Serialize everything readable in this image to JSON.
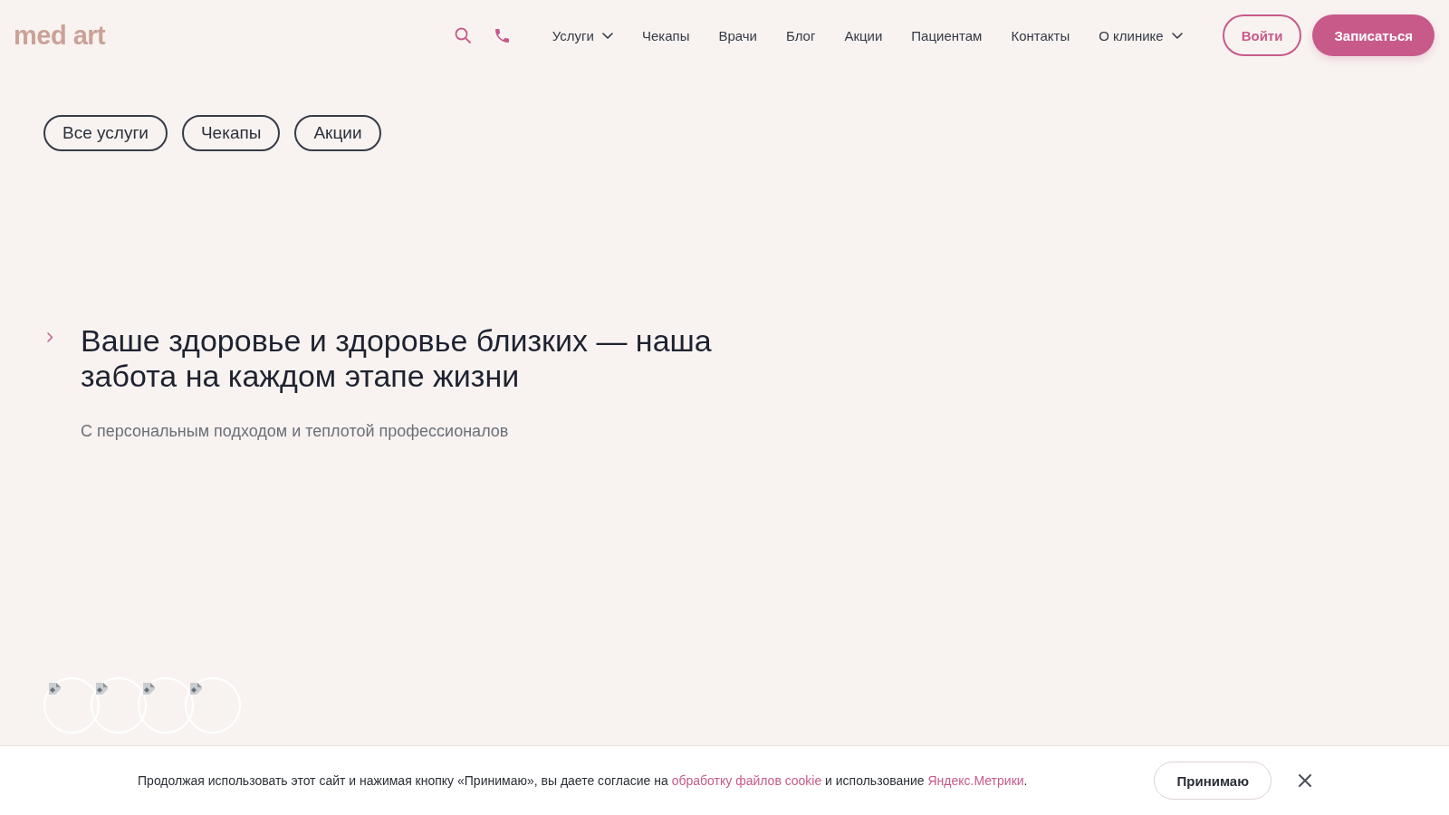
{
  "header": {
    "logo": "med art",
    "nav": [
      {
        "label": "Услуги",
        "dropdown": true
      },
      {
        "label": "Чекапы",
        "dropdown": false
      },
      {
        "label": "Врачи",
        "dropdown": false
      },
      {
        "label": "Блог",
        "dropdown": false
      },
      {
        "label": "Акции",
        "dropdown": false
      },
      {
        "label": "Пациентам",
        "dropdown": false
      },
      {
        "label": "Контакты",
        "dropdown": false
      },
      {
        "label": "О клинике",
        "dropdown": true
      }
    ],
    "login_button": "Войти",
    "signup_button": "Записаться"
  },
  "filter_chips": [
    {
      "label": "Все услуги"
    },
    {
      "label": "Чекапы"
    },
    {
      "label": "Акции"
    }
  ],
  "hero": {
    "title": "Ваше здоровье и здоровье близких — наша забота на каждом этапе жизни",
    "subtitle": "С персональным подходом и теплотой профессионалов"
  },
  "thumbnails": [
    {
      "broken": true
    },
    {
      "broken": true
    },
    {
      "broken": true
    },
    {
      "broken": true
    }
  ],
  "cookie_banner": {
    "text": [
      {
        "kind": "text",
        "text": "Продолжая использовать этот сайт и нажимая кнопку «Принимаю», вы даете согласие на "
      },
      {
        "kind": "link",
        "text": "обработку файлов cookie"
      },
      {
        "kind": "text",
        "text": " и использование "
      },
      {
        "kind": "link",
        "text": "Яндекс.Метрики"
      },
      {
        "kind": "text",
        "text": "."
      }
    ],
    "accept_button": "Принимаю"
  }
}
